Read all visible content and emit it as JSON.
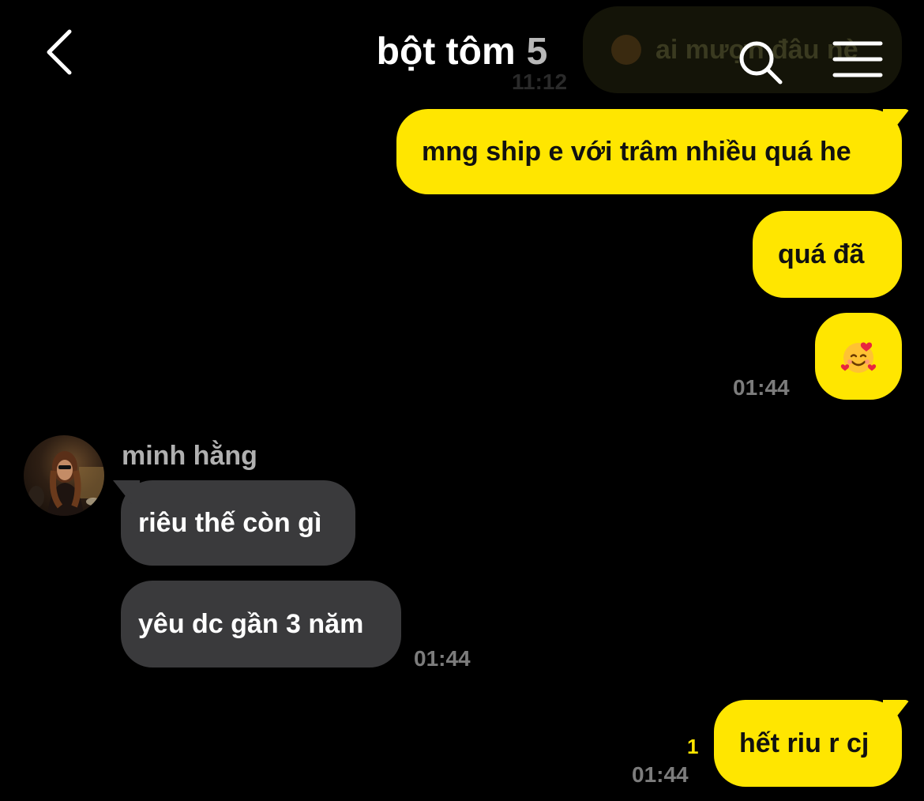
{
  "ghost_message": {
    "text": "ai mượn đâu nè",
    "time": "11:12"
  },
  "header": {
    "title": "bột tôm",
    "member_count": "5",
    "back_icon": "chevron-left-icon",
    "search_icon": "search-icon",
    "menu_icon": "hamburger-menu-icon"
  },
  "messages": {
    "m1": {
      "text": "mng ship e với trâm nhiều quá he"
    },
    "m2": {
      "text": "quá đã"
    },
    "m3": {
      "emoji": "smiling-face-with-hearts",
      "time": "01:44"
    },
    "sender_name": "minh hằng",
    "m4": {
      "text": "riêu thế còn gì"
    },
    "m5": {
      "text": "yêu dc gần 3 năm",
      "time": "01:44"
    },
    "m6": {
      "text": "hết riu r cj",
      "unread": "1",
      "time": "01:44"
    }
  },
  "colors": {
    "mine_bubble": "#ffe600",
    "theirs_bubble": "#3a3a3c",
    "background": "#000000",
    "timestamp": "#7c7c7c"
  }
}
